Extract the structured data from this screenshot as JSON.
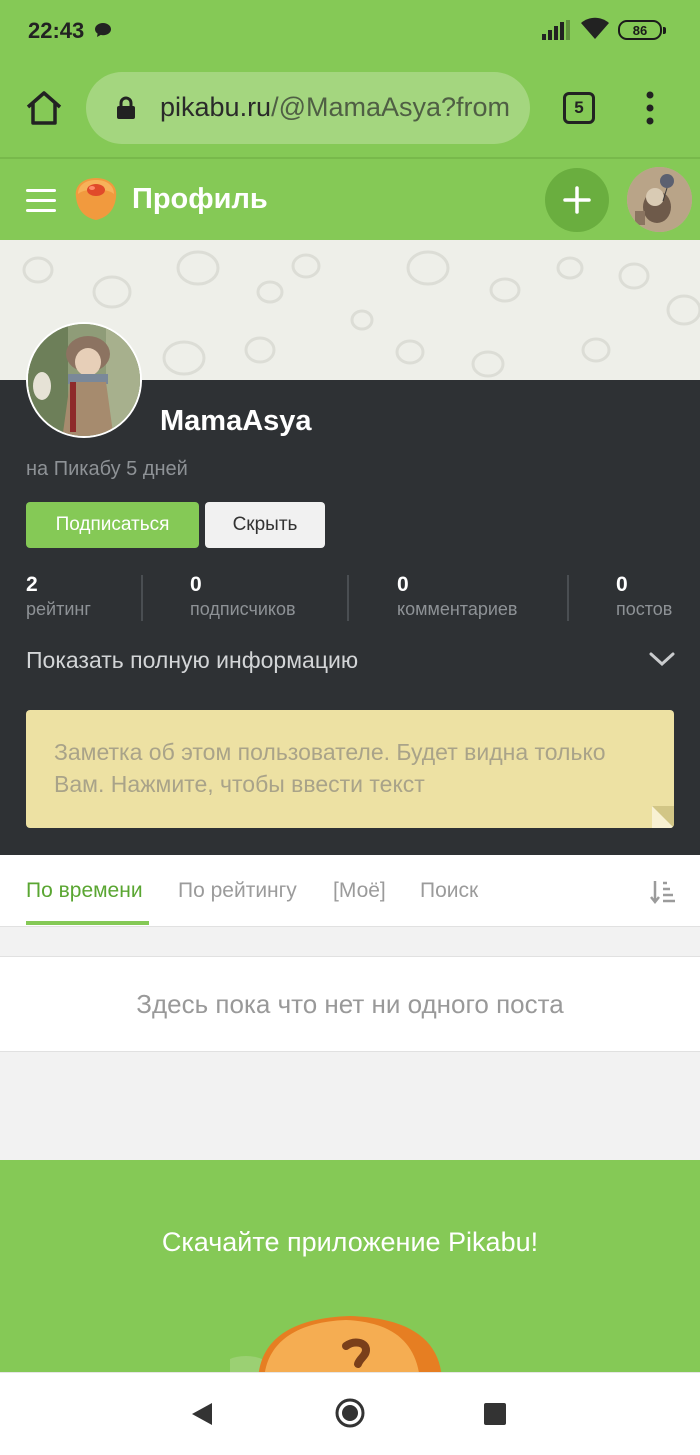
{
  "status_bar": {
    "time": "22:43",
    "battery": "86"
  },
  "browser": {
    "url_host": "pikabu.ru",
    "url_path": "/@MamaAsya?from",
    "tab_count": "5"
  },
  "header": {
    "title": "Профиль"
  },
  "profile": {
    "username": "MamaAsya",
    "on_pikabu": "на Пикабу 5 дней",
    "subscribe_label": "Подписаться",
    "hide_label": "Скрыть",
    "stats": [
      {
        "value": "2",
        "label": "рейтинг"
      },
      {
        "value": "0",
        "label": "подписчиков"
      },
      {
        "value": "0",
        "label": "комментариев"
      },
      {
        "value": "0",
        "label": "постов"
      }
    ],
    "show_info": "Показать полную информацию",
    "note_placeholder": "Заметка об этом пользователе. Будет видна только Вам. Нажмите, чтобы ввести текст"
  },
  "tabs": [
    {
      "label": "По времени",
      "active": true
    },
    {
      "label": "По рейтингу",
      "active": false
    },
    {
      "label": "[Моё]",
      "active": false
    },
    {
      "label": "Поиск",
      "active": false
    }
  ],
  "empty_state": "Здесь пока что нет ни одного поста",
  "promo": {
    "text": "Скачайте приложение Pikabu!"
  },
  "colors": {
    "brand_green": "#85c956",
    "profile_bg": "#2e3134",
    "note_bg": "#ede1a3"
  }
}
